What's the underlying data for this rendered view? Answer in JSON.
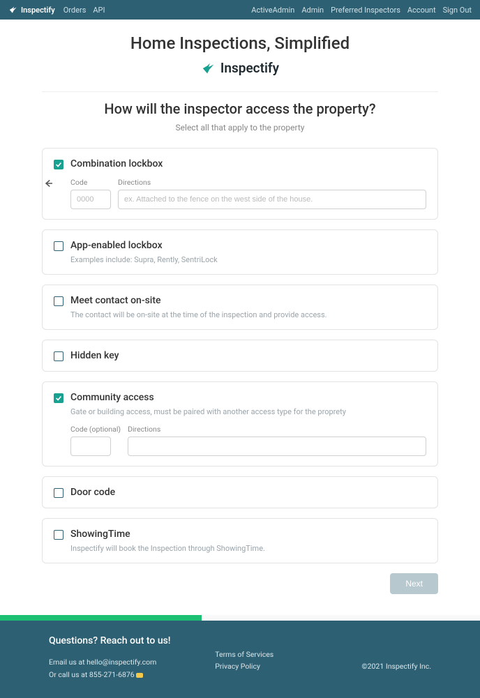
{
  "nav": {
    "brand": "Inspectify",
    "left": [
      "Orders",
      "API"
    ],
    "right": [
      "ActiveAdmin",
      "Admin",
      "Preferred Inspectors",
      "Account",
      "Sign Out"
    ]
  },
  "headline": "Home Inspections, Simplified",
  "brand_logo_text": "Inspectify",
  "question": {
    "title": "How will the inspector access the property?",
    "sub": "Select all that apply to the property"
  },
  "options": {
    "combo": {
      "title": "Combination lockbox",
      "code_label": "Code",
      "code_placeholder": "0000",
      "dir_label": "Directions",
      "dir_placeholder": "ex. Attached to the fence on the west side of the house."
    },
    "app": {
      "title": "App-enabled lockbox",
      "desc": "Examples include: Supra, Rently, SentriLock"
    },
    "meet": {
      "title": "Meet contact on-site",
      "desc": "The contact will be on-site at the time of the inspection and provide access."
    },
    "hidden": {
      "title": "Hidden key"
    },
    "community": {
      "title": "Community access",
      "desc": "Gate or building access, must be paired with another access type for the proprety",
      "code_label": "Code (optional)",
      "dir_label": "Directions"
    },
    "door": {
      "title": "Door code"
    },
    "showing": {
      "title": "ShowingTime",
      "desc": "Inspectify will book the Inspection through ShowingTime."
    }
  },
  "next_label": "Next",
  "footer": {
    "heading": "Questions? Reach out to us!",
    "email_line": "Email us at hello@inspectify.com",
    "call_line": "Or call us at 855-271-6876",
    "tos": "Terms of Services",
    "privacy": "Privacy Policy",
    "copyright": "©2021 Inspectify Inc."
  }
}
